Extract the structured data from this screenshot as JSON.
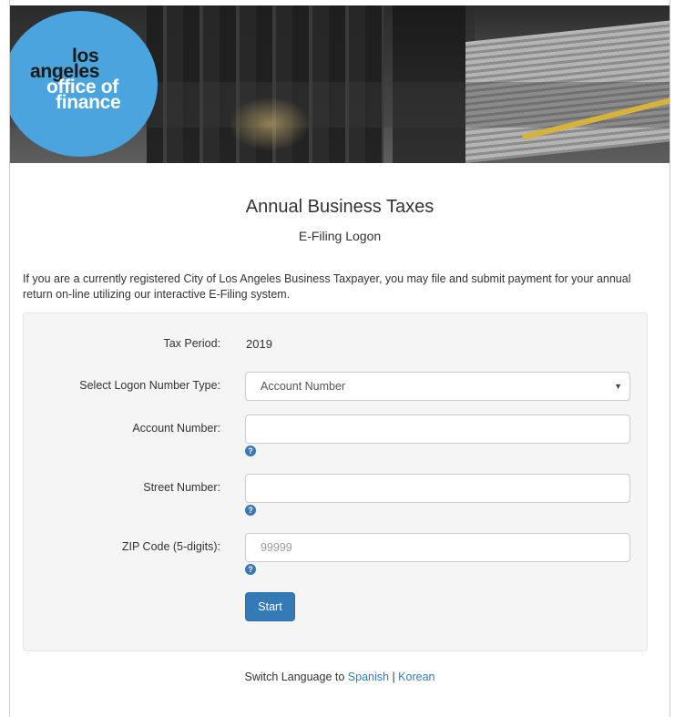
{
  "header": {
    "logo": {
      "line1": "los",
      "line2": "angeles",
      "line3": "office of",
      "line4": "finance"
    }
  },
  "page": {
    "title": "Annual Business Taxes",
    "subtitle": "E-Filing Logon",
    "intro": "If you are a currently registered City of Los Angeles Business Taxpayer, you may file and submit payment for your annual return on-line utilizing our interactive E-Filing system."
  },
  "form": {
    "tax_period_label": "Tax Period:",
    "tax_period_value": "2019",
    "logon_type_label": "Select Logon Number Type:",
    "logon_type_selected": "Account Number",
    "account_number_label": "Account Number:",
    "account_number_value": "",
    "street_number_label": "Street Number:",
    "street_number_value": "",
    "zip_label": "ZIP Code (5-digits):",
    "zip_placeholder": "99999",
    "help_glyph": "?",
    "caret_glyph": "▼",
    "start_label": "Start"
  },
  "language": {
    "prefix": "Switch Language to ",
    "spanish": "Spanish",
    "separator": " | ",
    "korean": "Korean"
  },
  "colors": {
    "logo_blue": "#4aa4dd",
    "primary_button": "#337ab7",
    "link": "#337ab7",
    "help_icon": "#3a78b8"
  },
  "icons": {
    "help": "question-circle-icon",
    "select_caret": "caret-down-icon"
  }
}
